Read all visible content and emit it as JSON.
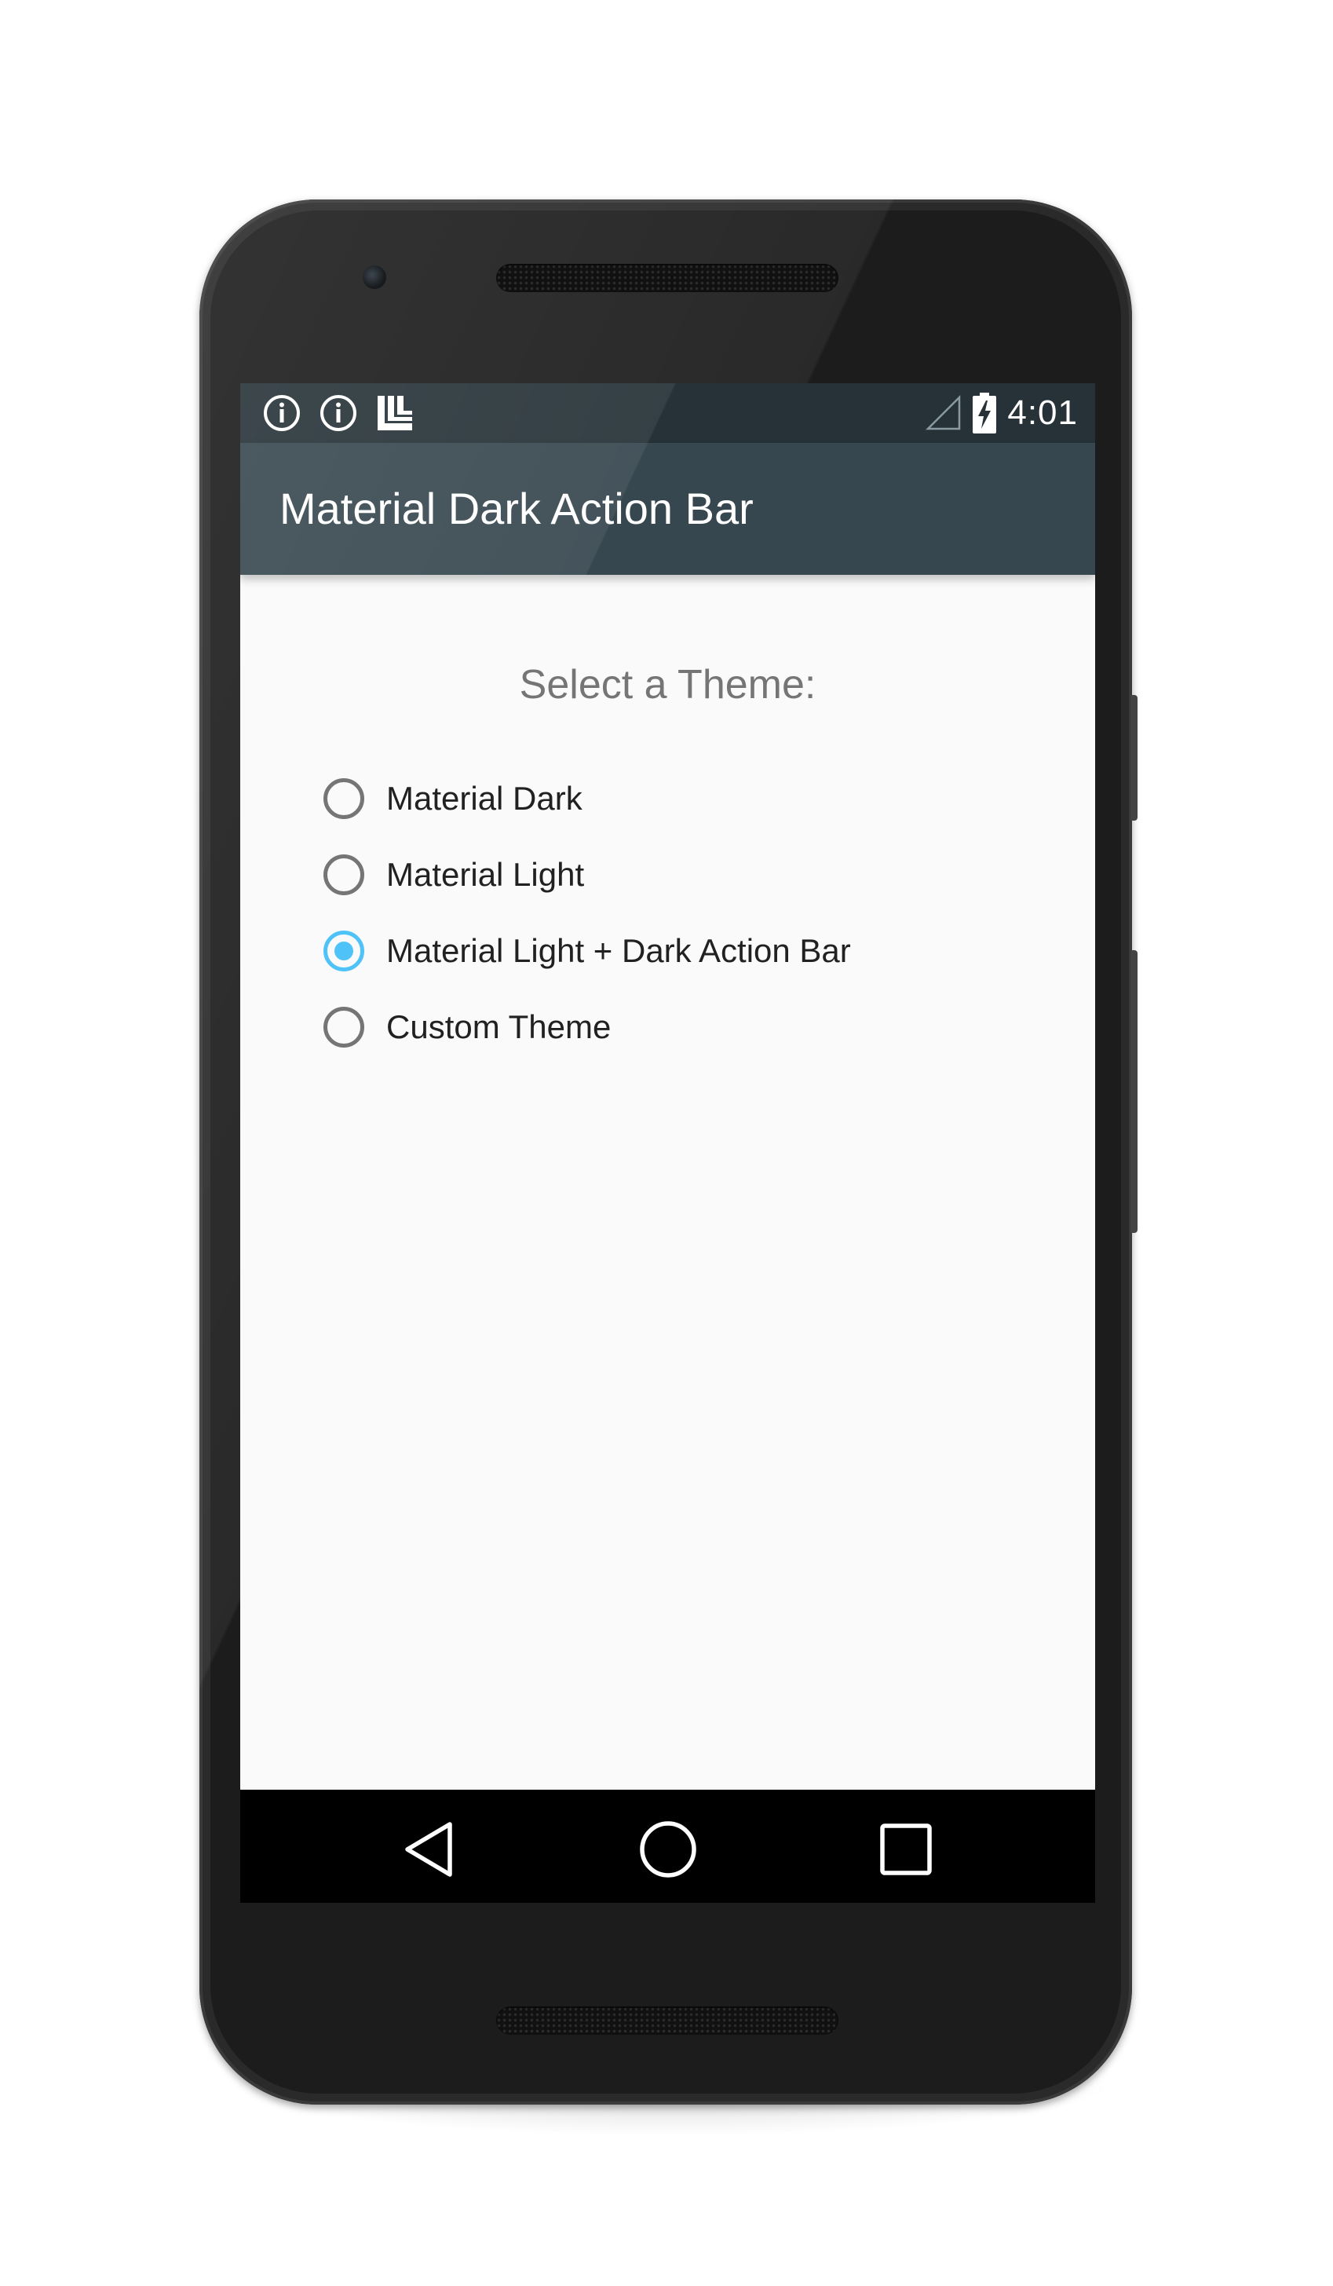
{
  "status_bar": {
    "icons_left": [
      "info-icon",
      "info-icon",
      "launcher-icon"
    ],
    "icons_right": [
      "signal-icon",
      "battery-charging-icon"
    ],
    "time": "4:01"
  },
  "action_bar": {
    "title": "Material Dark Action Bar"
  },
  "content": {
    "prompt": "Select a Theme:",
    "options": [
      {
        "label": "Material Dark",
        "checked": false
      },
      {
        "label": "Material Light",
        "checked": false
      },
      {
        "label": "Material Light + Dark Action Bar",
        "checked": true
      },
      {
        "label": "Custom Theme",
        "checked": false
      }
    ]
  },
  "navigation": {
    "buttons": [
      "back-icon",
      "home-icon",
      "recents-icon"
    ]
  },
  "colors": {
    "status_bar": "#263238",
    "action_bar": "#37474f",
    "accent": "#4fc3f7",
    "background": "#fafafa"
  }
}
